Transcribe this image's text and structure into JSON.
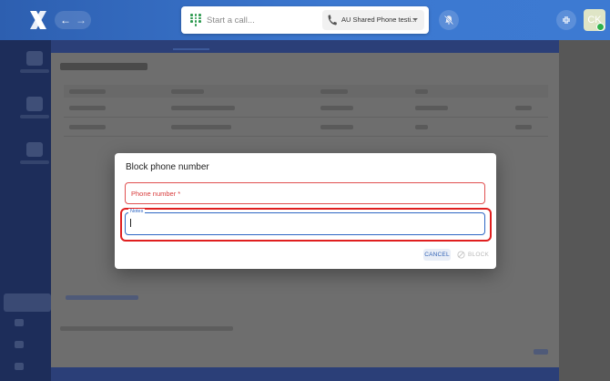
{
  "header": {
    "logo": "x-logo",
    "nav": {
      "back_icon": "arrow-left-icon",
      "forward_icon": "arrow-right-icon"
    },
    "call": {
      "dialpad_icon": "dialpad-icon",
      "placeholder": "Start a call...",
      "line_selector": {
        "icon": "phone-icon",
        "selected": "AU Shared Phone testi..."
      }
    },
    "notifications_icon": "bell-off-icon",
    "collapse_icon": "collapse-icon",
    "user": {
      "initials": "CK",
      "status": "online",
      "status_color": "#2fb24c"
    }
  },
  "dialog": {
    "title": "Block phone number",
    "phone_field": {
      "label": "Phone number *",
      "state": "error",
      "error_color": "#d83b3b"
    },
    "notes_field": {
      "label": "Notes",
      "value": "",
      "state": "focused",
      "focus_color": "#2e67c4"
    },
    "buttons": {
      "cancel": "CANCEL",
      "block": "BLOCK",
      "block_icon": "block-icon",
      "block_state": "disabled"
    }
  },
  "highlight": {
    "target": "notes-field",
    "color": "#e01f1f"
  },
  "colors": {
    "header": "#3c78d0",
    "accent": "#3363b5",
    "overlay": "#6e6e6e"
  }
}
